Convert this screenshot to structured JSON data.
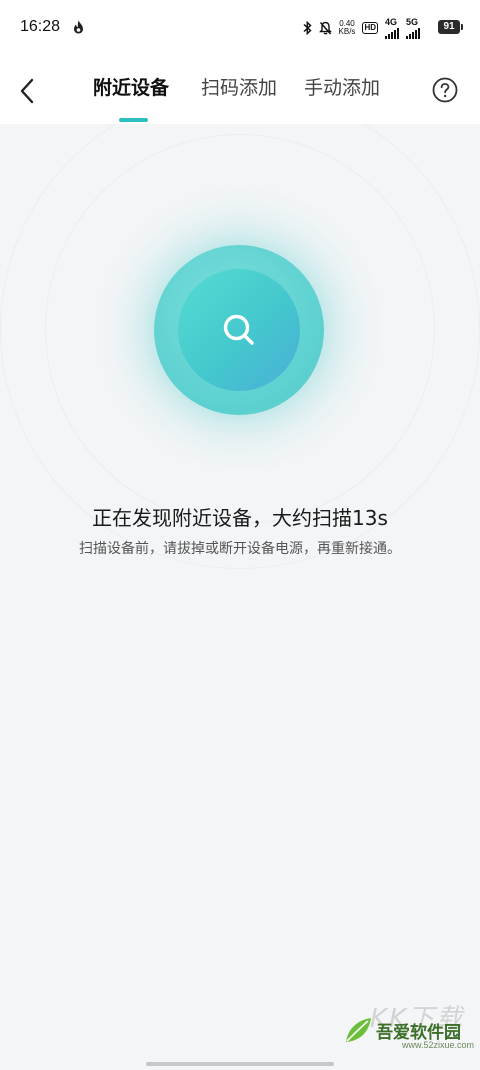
{
  "status_bar": {
    "time": "16:28",
    "net_speed_value": "0.40",
    "net_speed_unit": "KB/s",
    "hd_label": "HD",
    "sim1_tag": "4G",
    "sim2_tag": "5G",
    "battery": "91"
  },
  "header": {
    "tabs": [
      {
        "label": "附近设备",
        "active": true
      },
      {
        "label": "扫码添加",
        "active": false
      },
      {
        "label": "手动添加",
        "active": false
      }
    ],
    "accent_color": "#2bc0bf"
  },
  "scan": {
    "title": "正在发现附近设备，大约扫描13s",
    "hint": "扫描设备前，请拔掉或断开设备电源，再重新接通。"
  },
  "watermark": {
    "top_text": "KK下载",
    "name": "吾爱软件园",
    "url": "www.52zixue.com"
  }
}
